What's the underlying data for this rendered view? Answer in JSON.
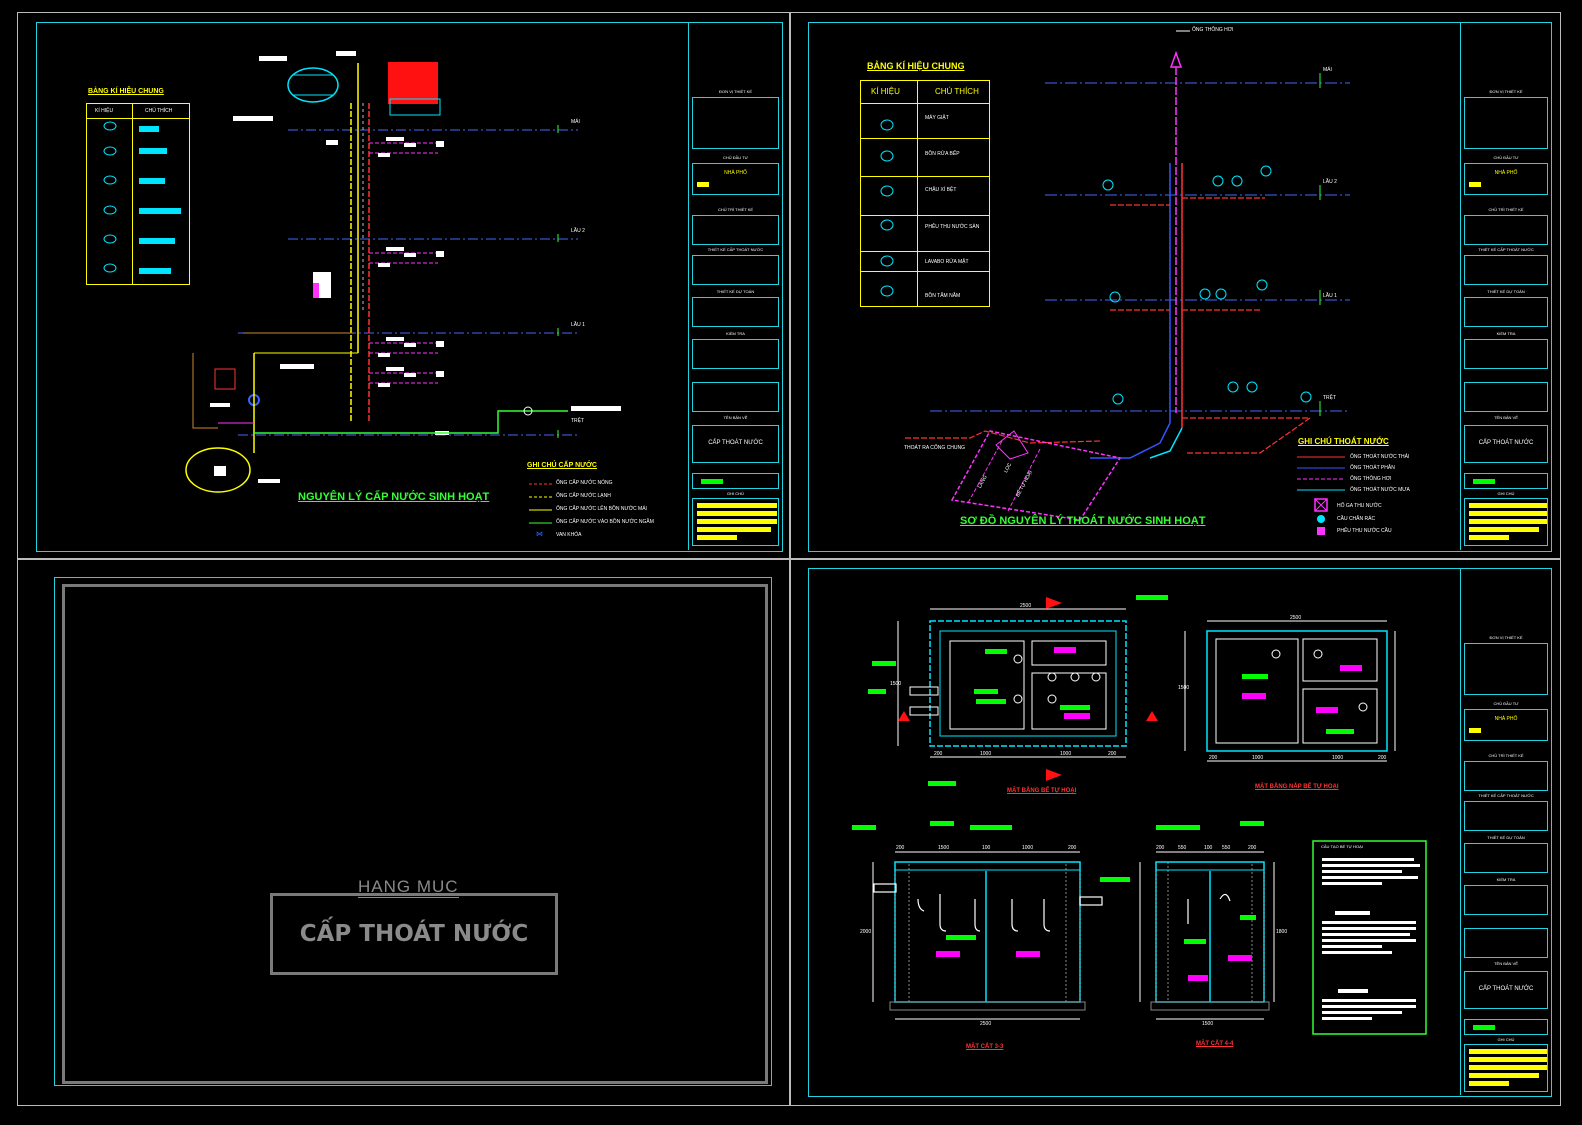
{
  "sheets": {
    "supply": {
      "legend_title": "BẢNG KÍ HIỆU CHUNG",
      "legend_headers": [
        "KÍ HIỆU",
        "CHÚ THÍCH"
      ],
      "floor_labels": [
        "MÁI",
        "LẦU 2",
        "LẦU 1",
        "TRỆT"
      ],
      "notes_title": "GHI CHÚ CẤP NƯỚC",
      "notes": [
        "ỐNG CẤP NƯỚC NÓNG",
        "ỐNG CẤP NƯỚC LẠNH",
        "ỐNG CẤP NƯỚC LÊN BỒN NƯỚC MÁI",
        "ỐNG CẤP NƯỚC VÀO BỒN NƯỚC NGẦM",
        "VAN KHÓA"
      ],
      "drawing_title": "NGUYÊN LÝ CẤP NƯỚC SINH HOẠT"
    },
    "drainage": {
      "legend_title": "BẢNG KÍ HIỆU CHUNG",
      "legend_headers": [
        "KÍ HIỆU",
        "CHÚ THÍCH"
      ],
      "legend_items": [
        "MÁY GIẶT",
        "BỒN RỬA BẾP",
        "CHẬU XÍ BỆT",
        "PHỄU THU NƯỚC SÀN",
        "LAVABO RỬA MẶT",
        "BỒN TẮM NẰM"
      ],
      "vent_label": "ỐNG THÔNG HƠI",
      "floor_labels": [
        "MÁI",
        "LẦU 2",
        "LẦU 1",
        "TRỆT"
      ],
      "outlet_label": "THOÁT RA CỐNG CHUNG",
      "tank_labels": [
        "LẮNG",
        "LỌC",
        "BỂ TỰ HOẠI"
      ],
      "notes_title": "GHI CHÚ THOÁT NƯỚC",
      "notes": [
        "ỐNG THOÁT NƯỚC THẢI",
        "ỐNG THOÁT PHÂN",
        "ỐNG THÔNG HƠI",
        "ỐNG THOÁT NƯỚC MƯA",
        "HỐ GA THU NƯỚC",
        "CẦU CHẮN RÁC",
        "PHỄU THU NƯỚC CẦU"
      ],
      "drawing_title": "SƠ ĐỒ NGUYÊN LÝ THOÁT NƯỚC SINH HOẠT"
    },
    "cover": {
      "subtitle": "HẠNG MỤC",
      "title": "CẤP THOÁT NƯỚC"
    },
    "septic": {
      "plan_title": "MẶT BẰNG BỂ TỰ HOẠI",
      "cover_plan_title": "MẶT BẰNG NẮP BỂ TỰ HOẠI",
      "section_3_title": "MẶT CẮT 3-3",
      "section_4_title": "MẶT CẮT 4-4",
      "notes_title": "CẤU TẠO BỂ TỰ HOẠI",
      "dims_plan": [
        "2500",
        "1500",
        "200",
        "1000",
        "1000",
        "200"
      ],
      "dims_cover": [
        "2500",
        "1500",
        "200",
        "1000",
        "1000",
        "200"
      ],
      "dims_sec3": [
        "200",
        "1500",
        "100",
        "1000",
        "200",
        "2500",
        "2000"
      ],
      "dims_sec4": [
        "200",
        "550",
        "100",
        "550",
        "200",
        "1500",
        "1800"
      ]
    }
  },
  "title_block": {
    "job_title": "CẤP THOÁT NƯỚC",
    "project": "NHÀ PHỐ",
    "labels": [
      "ĐƠN VỊ THIẾT KẾ",
      "CHỦ ĐẦU TƯ",
      "CHỦ TRÌ THIẾT KẾ",
      "THIẾT KẾ CẤP THOÁT NƯỚC",
      "THIẾT KẾ DỰ TOÁN",
      "KIỂM TRA",
      "TÊN BẢN VẼ",
      "KÝ HIỆU",
      "BẢN THÔNG",
      "GHI CHÚ"
    ]
  },
  "colors": {
    "frame": "#1fd3e0",
    "hot_water": "#ff3333",
    "cold_water": "#ffff00",
    "green_pipe": "#33ff33",
    "wastewater": "#ff3333",
    "soil": "#3355ff",
    "vent": "#ff33ff",
    "rain": "#00e5ff"
  }
}
